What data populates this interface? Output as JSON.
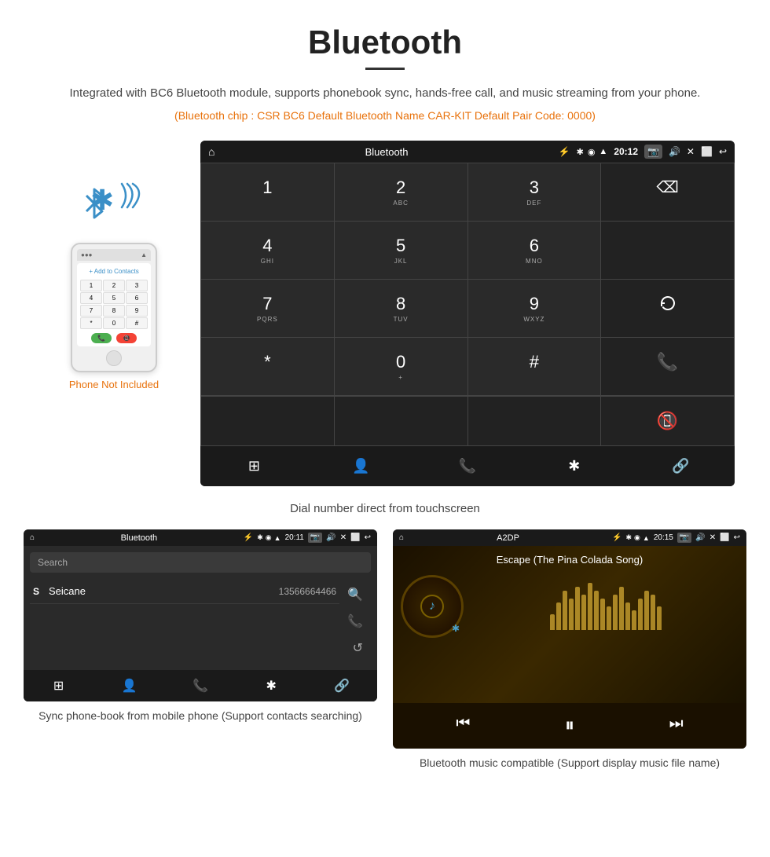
{
  "page": {
    "title": "Bluetooth",
    "description": "Integrated with BC6 Bluetooth module, supports phonebook sync, hands-free call, and music streaming from your phone.",
    "specs": "(Bluetooth chip : CSR BC6    Default Bluetooth Name CAR-KIT    Default Pair Code: 0000)",
    "dial_caption": "Dial number direct from touchscreen",
    "phone_not_included": "Phone Not Included",
    "bottom_left_caption": "Sync phone-book from mobile phone\n(Support contacts searching)",
    "bottom_right_caption": "Bluetooth music compatible\n(Support display music file name)"
  },
  "dialpad_screen": {
    "status_title": "Bluetooth",
    "status_time": "20:12",
    "keys": [
      {
        "main": "1",
        "sub": ""
      },
      {
        "main": "2",
        "sub": "ABC"
      },
      {
        "main": "3",
        "sub": "DEF"
      },
      {
        "main": "⌫",
        "sub": "",
        "type": "backspace"
      },
      {
        "main": "4",
        "sub": "GHI"
      },
      {
        "main": "5",
        "sub": "JKL"
      },
      {
        "main": "6",
        "sub": "MNO"
      },
      {
        "main": "",
        "sub": "",
        "type": "empty"
      },
      {
        "main": "7",
        "sub": "PQRS"
      },
      {
        "main": "8",
        "sub": "TUV"
      },
      {
        "main": "9",
        "sub": "WXYZ"
      },
      {
        "main": "↺",
        "sub": "",
        "type": "refresh"
      },
      {
        "main": "*",
        "sub": ""
      },
      {
        "main": "0",
        "sub": "+"
      },
      {
        "main": "#",
        "sub": ""
      },
      {
        "main": "📞",
        "sub": "",
        "type": "call-green"
      },
      {
        "main": "📵",
        "sub": "",
        "type": "call-red"
      }
    ],
    "footer_icons": [
      "⊞",
      "👤",
      "📞",
      "✱",
      "🔗"
    ]
  },
  "phonebook_screen": {
    "status_title": "Bluetooth",
    "status_time": "20:11",
    "search_placeholder": "Search",
    "contact_letter": "S",
    "contact_name": "Seicane",
    "contact_number": "13566664466",
    "footer_icons": [
      "⊞",
      "👤",
      "📞",
      "✱",
      "🔗"
    ]
  },
  "music_screen": {
    "status_title": "A2DP",
    "status_time": "20:15",
    "song_title": "Escape (The Pina Colada Song)",
    "eq_bars": [
      20,
      35,
      50,
      40,
      55,
      45,
      60,
      50,
      40,
      30,
      45,
      55,
      35,
      25,
      40,
      50,
      45,
      30
    ],
    "controls": [
      "⏮",
      "⏭",
      "⏸"
    ]
  },
  "phone_illustration": {
    "keys": [
      "1",
      "2",
      "3",
      "4",
      "5",
      "6",
      "7",
      "8",
      "9",
      "*",
      "0",
      "#"
    ],
    "add_contacts": "+ Add to Contacts"
  }
}
